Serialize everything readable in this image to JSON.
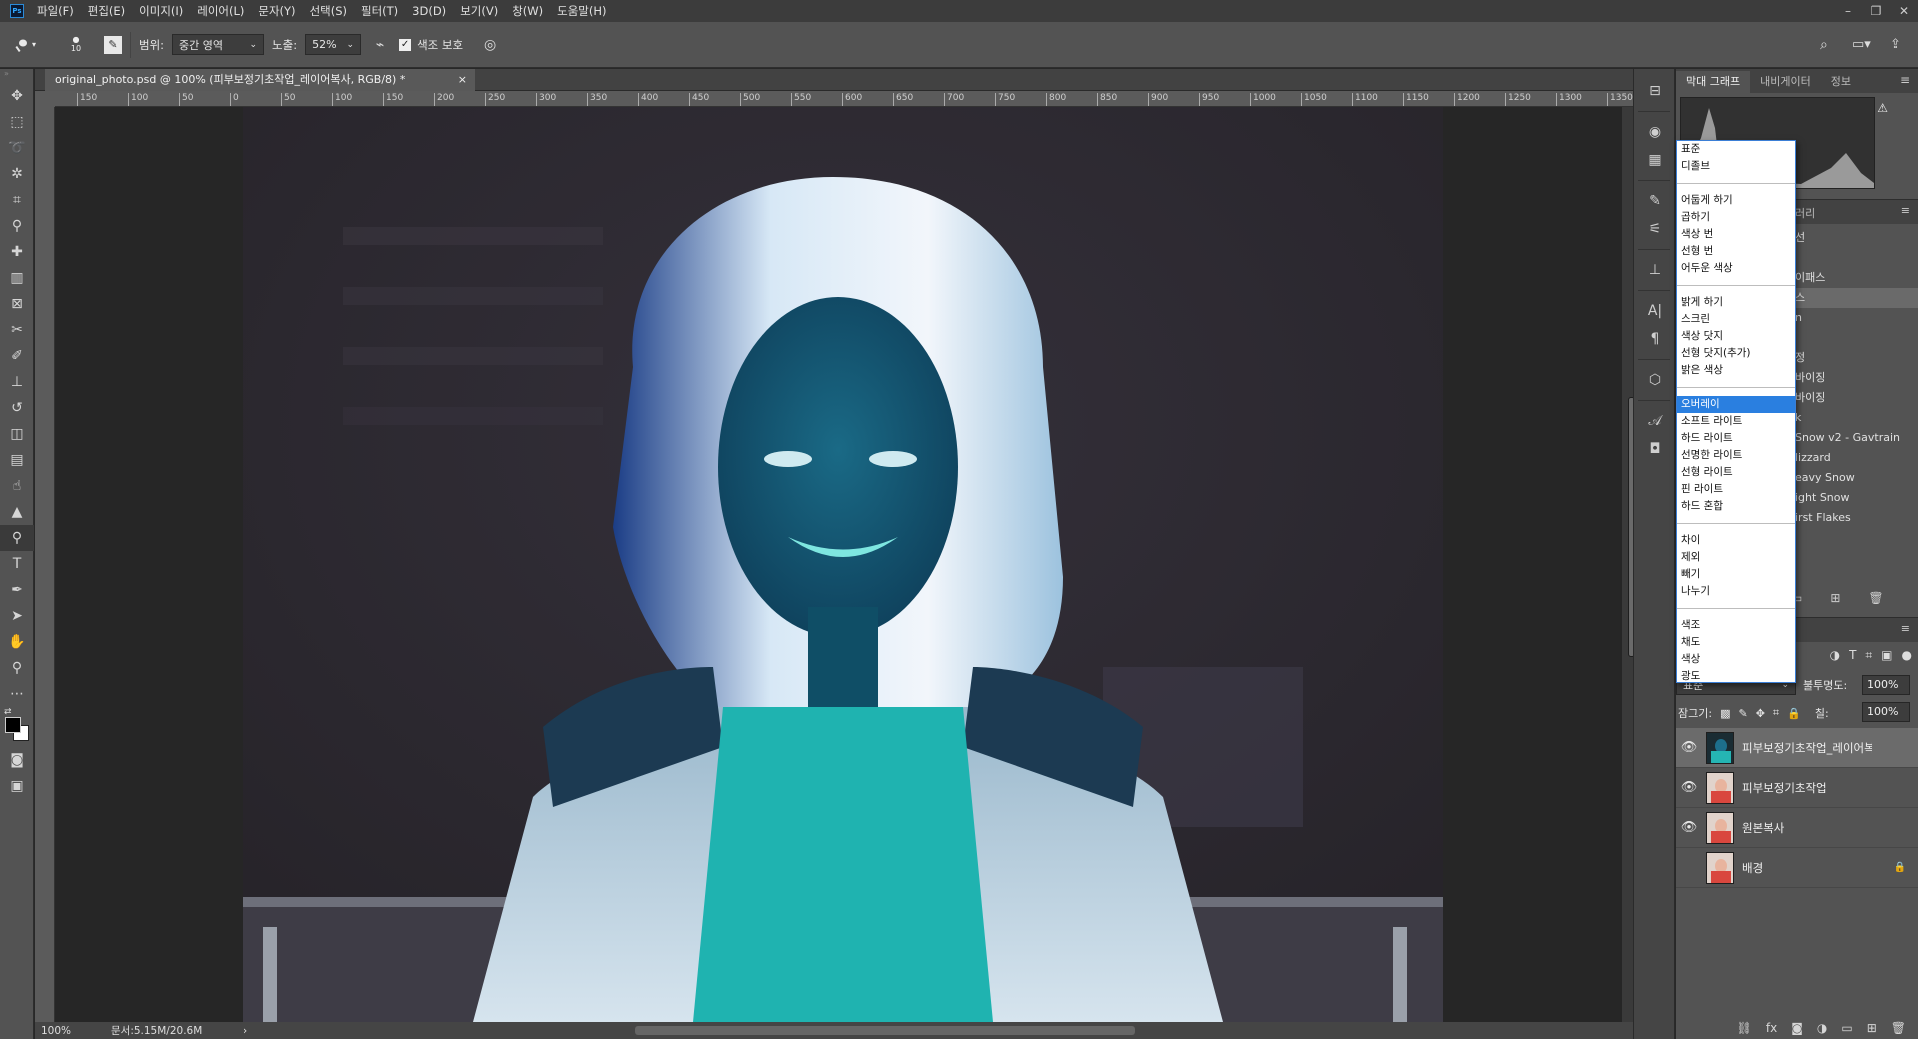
{
  "menubar": {
    "logo": "Ps",
    "items": [
      "파일(F)",
      "편집(E)",
      "이미지(I)",
      "레이어(L)",
      "문자(Y)",
      "선택(S)",
      "필터(T)",
      "3D(D)",
      "보기(V)",
      "창(W)",
      "도움말(H)"
    ],
    "window_controls": [
      "–",
      "❐",
      "✕"
    ]
  },
  "options": {
    "brush_size": "10",
    "range_label": "범위:",
    "range_value": "중간 영역",
    "exposure_label": "노출:",
    "exposure_value": "52%",
    "protect_tones_label": "색조 보호",
    "protect_tones_checked": true
  },
  "document": {
    "tab_title": "original_photo.psd @ 100% (피부보정기초작업_레이어복사, RGB/8) *",
    "close": "×"
  },
  "ruler": {
    "top_ticks": [
      "150",
      "100",
      "50",
      "0",
      "50",
      "100",
      "150",
      "200",
      "250",
      "300",
      "350",
      "400",
      "450",
      "500",
      "550",
      "600",
      "650",
      "700",
      "750",
      "800",
      "850",
      "900",
      "950",
      "1000",
      "1050",
      "1100",
      "1150",
      "1200",
      "1250",
      "1300",
      "1350"
    ]
  },
  "status": {
    "zoom": "100%",
    "doc_info": "문서:5.15M/20.6M",
    "arrow": "›"
  },
  "top_panel": {
    "tabs": [
      "막대 그래프",
      "내비게이터",
      "정보"
    ],
    "warning_icon": "⚠"
  },
  "mid_panel": {
    "tab_label": "러리",
    "rows": [
      "선",
      "",
      "이패스",
      "스",
      "n",
      "",
      "정",
      "바이징",
      "바이징",
      "k",
      "Snow v2 - Gavtrain",
      "lizzard",
      "eavy Snow",
      "ight Snow",
      "irst Flakes"
    ],
    "selected_row": 3
  },
  "blend_modes": {
    "groups": [
      [
        "표준",
        "디졸브"
      ],
      [
        "어둡게 하기",
        "곱하기",
        "색상 번",
        "선형 번",
        "어두운 색상"
      ],
      [
        "밝게 하기",
        "스크린",
        "색상 닷지",
        "선형 닷지(추가)",
        "밝은 색상"
      ],
      [
        "오버레이",
        "소프트 라이트",
        "하드 라이트",
        "선명한 라이트",
        "선형 라이트",
        "핀 라이트",
        "하드 혼합"
      ],
      [
        "차이",
        "제외",
        "빼기",
        "나누기"
      ],
      [
        "색조",
        "채도",
        "색상",
        "광도"
      ]
    ],
    "highlighted": "오버레이"
  },
  "layers": {
    "blend_value": "표준",
    "opacity_label": "불투명도:",
    "opacity_value": "100%",
    "lock_label": "잠그기:",
    "fill_label": "칠:",
    "fill_value": "100%",
    "items": [
      {
        "name": "피부보정기초작업_레이어복사",
        "visible": true,
        "selected": true,
        "locked": false
      },
      {
        "name": "피부보정기초작업",
        "visible": true,
        "selected": false,
        "locked": false
      },
      {
        "name": "원본복사",
        "visible": true,
        "selected": false,
        "locked": false
      },
      {
        "name": "배경",
        "visible": false,
        "selected": false,
        "locked": true
      }
    ]
  },
  "colors": {
    "accent": "#2a7fe0",
    "panel": "#535353",
    "canvas_bg": "#262626"
  }
}
